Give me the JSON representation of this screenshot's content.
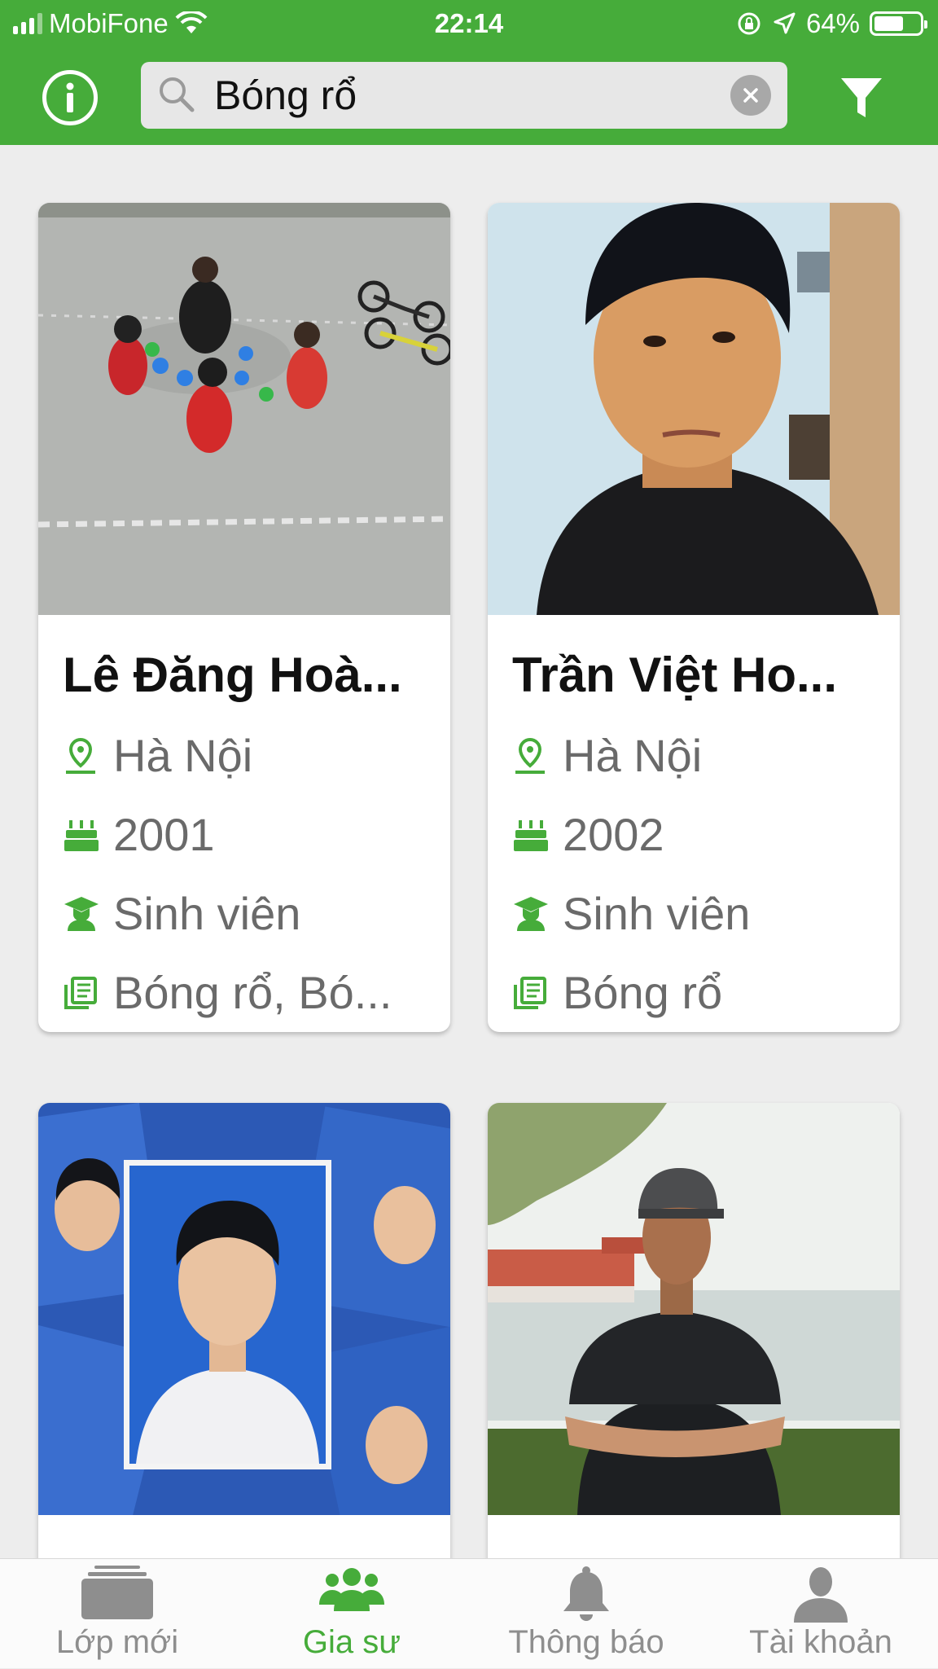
{
  "status_bar": {
    "carrier": "MobiFone",
    "time": "22:14",
    "battery": "64%",
    "battery_level": 0.64
  },
  "search": {
    "query": "Bóng rổ",
    "placeholder": ""
  },
  "colors": {
    "brand_green": "#46ac3a",
    "text_gray": "#6a6a6a",
    "tab_inactive": "#8e8e8e"
  },
  "tutors": [
    {
      "name": "Lê Đăng Hoà...",
      "location": "Hà Nội",
      "birth_year": "2001",
      "occupation": "Sinh viên",
      "subjects": "Bóng rổ, Bó..."
    },
    {
      "name": "Trần Việt Ho...",
      "location": "Hà Nội",
      "birth_year": "2002",
      "occupation": "Sinh viên",
      "subjects": "Bóng rổ"
    }
  ],
  "tabs": [
    {
      "label": "Lớp mới",
      "icon": "folder-icon",
      "active": false
    },
    {
      "label": "Gia sư",
      "icon": "group-icon",
      "active": true
    },
    {
      "label": "Thông báo",
      "icon": "bell-icon",
      "active": false
    },
    {
      "label": "Tài khoản",
      "icon": "user-icon",
      "active": false
    }
  ]
}
